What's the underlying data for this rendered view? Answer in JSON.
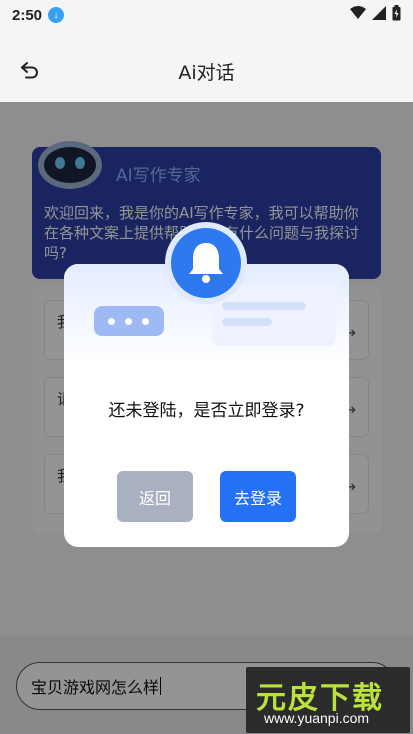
{
  "status_bar": {
    "time": "2:50",
    "download_icon": "download-icon",
    "wifi_icon": "wifi-icon",
    "signal_icon": "signal-icon",
    "battery_icon": "battery-icon"
  },
  "header": {
    "title": "Ai对话",
    "back_icon": "back-icon"
  },
  "intro_card": {
    "title": "AI写作专家",
    "text": "欢迎回来，我是你的AI写作专家，我可以帮助你在各种文案上提供帮助，你有什么问题与我探讨吗?"
  },
  "suggestions": [
    {
      "text": "我 章"
    },
    {
      "text": "请 划"
    },
    {
      "text": "我"
    }
  ],
  "dialog": {
    "message": "还未登陆，是否立即登录?",
    "back_label": "返回",
    "login_label": "去登录",
    "icon": "bell-icon"
  },
  "input": {
    "value": "宝贝游戏网怎么样"
  },
  "watermark": {
    "brand": "元皮下载",
    "url": "www.yuanpi.com"
  },
  "colors": {
    "primary": "#2472f3",
    "card": "#2b3fa8",
    "disabled": "#a9b0bf"
  }
}
